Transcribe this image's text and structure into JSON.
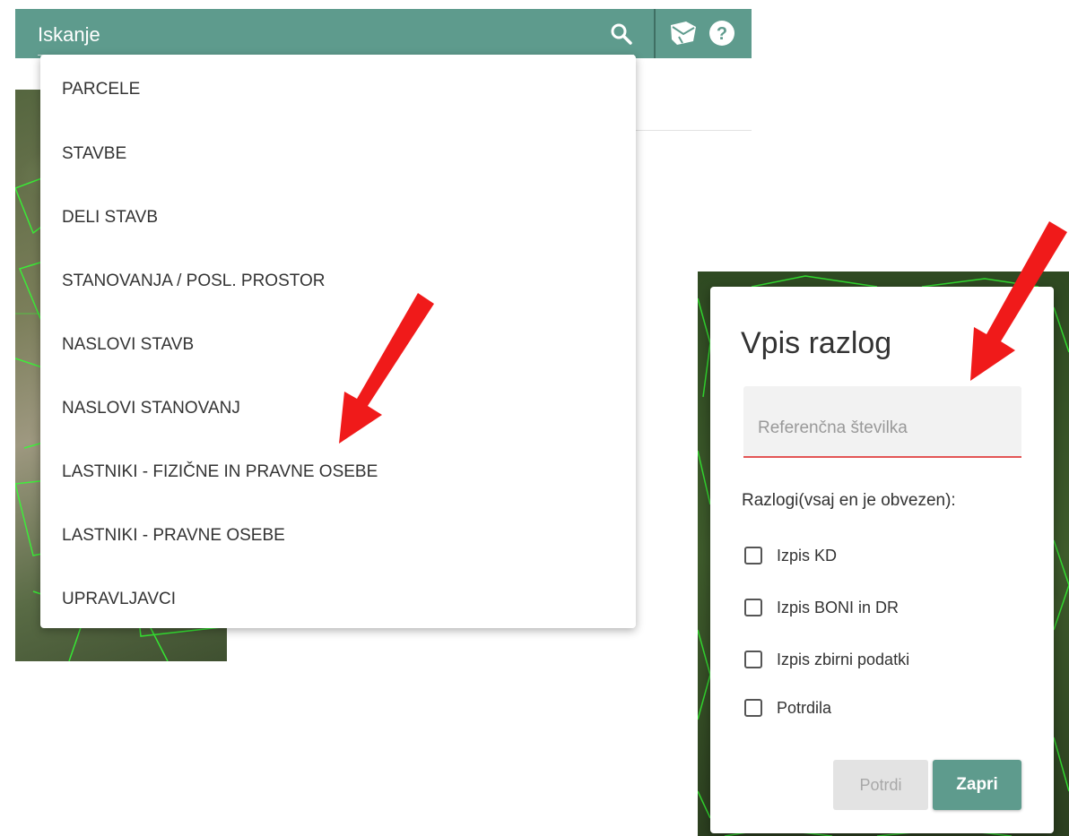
{
  "search": {
    "placeholder": "Iskanje",
    "dropdown_items": [
      "PARCELE",
      "STAVBE",
      "DELI STAVB",
      "STANOVANJA / POSL. PROSTOR",
      "NASLOVI STAVB",
      "NASLOVI STANOVANJ",
      "LASTNIKI - FIZIČNE IN PRAVNE OSEBE",
      "LASTNIKI - PRAVNE OSEBE",
      "UPRAVLJAVCI"
    ]
  },
  "toolbar_icons": [
    "search-icon",
    "mail-icon",
    "help-icon"
  ],
  "dialog": {
    "title": "Vpis razlog",
    "reference_placeholder": "Referenčna številka",
    "reasons_label": "Razlogi(vsaj en je obvezen):",
    "reasons": [
      {
        "label": "Izpis KD",
        "checked": false
      },
      {
        "label": "Izpis BONI in DR",
        "checked": false
      },
      {
        "label": "Izpis zbirni podatki",
        "checked": false
      },
      {
        "label": "Potrdila",
        "checked": false
      }
    ],
    "confirm_label": "Potrdi",
    "close_label": "Zapri"
  },
  "colors": {
    "toolbar": "#5e9b8d",
    "accent_button": "#5e9b8d",
    "input_underline": "#e35555",
    "annotation_arrow": "#f01a1a",
    "map_lines": "#33ff33"
  }
}
